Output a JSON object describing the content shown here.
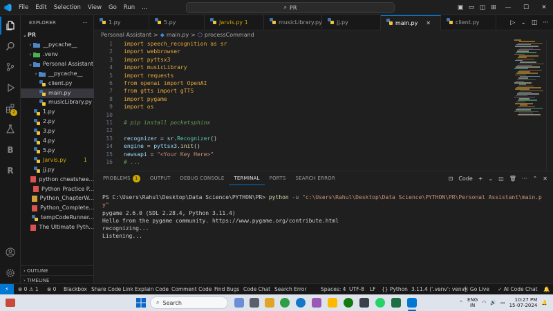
{
  "titlebar": {
    "menu": [
      "File",
      "Edit",
      "Selection",
      "View",
      "Go",
      "Run",
      "..."
    ],
    "search": "PR"
  },
  "sidebar": {
    "header": "EXPLORER",
    "root": "PR",
    "items": [
      {
        "label": "__pycache__",
        "depth": 1,
        "kind": "folder"
      },
      {
        "label": ".venv",
        "depth": 1,
        "kind": "folder"
      },
      {
        "label": "Personal Assistant",
        "depth": 1,
        "kind": "folder-open"
      },
      {
        "label": "__pycache__",
        "depth": 2,
        "kind": "folder"
      },
      {
        "label": "client.py",
        "depth": 2,
        "kind": "py"
      },
      {
        "label": "main.py",
        "depth": 2,
        "kind": "py",
        "selected": true
      },
      {
        "label": "musicLibrary.py",
        "depth": 2,
        "kind": "py"
      },
      {
        "label": "1.py",
        "depth": 1,
        "kind": "py"
      },
      {
        "label": "2.py",
        "depth": 1,
        "kind": "py"
      },
      {
        "label": "3.py",
        "depth": 1,
        "kind": "py"
      },
      {
        "label": "4.py",
        "depth": 1,
        "kind": "py"
      },
      {
        "label": "5.py",
        "depth": 1,
        "kind": "py"
      },
      {
        "label": "Jarvis.py",
        "depth": 1,
        "kind": "py",
        "warn": true,
        "badge": "1"
      },
      {
        "label": "jj.py",
        "depth": 1,
        "kind": "py"
      },
      {
        "label": "python cheatshee...",
        "depth": 1,
        "kind": "pdf"
      },
      {
        "label": "Python Practice P...",
        "depth": 1,
        "kind": "pdf"
      },
      {
        "label": "Python_ChapterW...",
        "depth": 1,
        "kind": "txt"
      },
      {
        "label": "Python_Complete...",
        "depth": 1,
        "kind": "pdf"
      },
      {
        "label": "tempCodeRunner...",
        "depth": 1,
        "kind": "py"
      },
      {
        "label": "The Ultimate Pyth...",
        "depth": 1,
        "kind": "pdf"
      }
    ],
    "outline": "OUTLINE",
    "timeline": "TIMELINE"
  },
  "tabs": [
    {
      "label": "1.py"
    },
    {
      "label": "5.py"
    },
    {
      "label": "Jarvis.py 1",
      "warn": true
    },
    {
      "label": "musicLibrary.py"
    },
    {
      "label": "jj.py"
    },
    {
      "label": "main.py",
      "active": true,
      "close": "✕"
    },
    {
      "label": "client.py"
    }
  ],
  "breadcrumb": [
    "Personal Assistant",
    ">",
    "main.py",
    ">",
    "processCommand"
  ],
  "editor": {
    "line_numbers": [
      "1",
      "2",
      "3",
      "4",
      "5",
      "6",
      "7",
      "8",
      "9",
      "10",
      "11",
      "12",
      "13",
      "14",
      "15",
      "16"
    ],
    "lines": [
      [
        {
          "t": "import",
          "c": "imp"
        },
        {
          "t": " speech_recognition ",
          "c": "imp"
        },
        {
          "t": "as",
          "c": "imp"
        },
        {
          "t": " sr",
          "c": "imp"
        }
      ],
      [
        {
          "t": "import",
          "c": "imp"
        },
        {
          "t": " webbrowser",
          "c": "imp"
        }
      ],
      [
        {
          "t": "import",
          "c": "imp"
        },
        {
          "t": " pyttsx3",
          "c": "imp"
        }
      ],
      [
        {
          "t": "import",
          "c": "imp"
        },
        {
          "t": " musicLibrary",
          "c": "imp"
        }
      ],
      [
        {
          "t": "import",
          "c": "imp"
        },
        {
          "t": " requests",
          "c": "imp"
        }
      ],
      [
        {
          "t": "from",
          "c": "imp"
        },
        {
          "t": " openai ",
          "c": "imp"
        },
        {
          "t": "import",
          "c": "imp"
        },
        {
          "t": " OpenAI",
          "c": "imp"
        }
      ],
      [
        {
          "t": "from",
          "c": "imp"
        },
        {
          "t": " gtts ",
          "c": "imp"
        },
        {
          "t": "import",
          "c": "imp"
        },
        {
          "t": " gTTS",
          "c": "imp"
        }
      ],
      [
        {
          "t": "import",
          "c": "imp"
        },
        {
          "t": " pygame",
          "c": "imp"
        }
      ],
      [
        {
          "t": "import",
          "c": "imp"
        },
        {
          "t": " os",
          "c": "imp"
        }
      ],
      [],
      [
        {
          "t": "# pip install pocketsphinx",
          "c": "com"
        }
      ],
      [],
      [
        {
          "t": "recognizer",
          "c": "plain"
        },
        {
          "t": " = ",
          "c": "plain"
        },
        {
          "t": "sr",
          "c": "plain"
        },
        {
          "t": ".",
          "c": "plain"
        },
        {
          "t": "Recognizer",
          "c": "plain"
        },
        {
          "t": "()",
          "c": "plain"
        }
      ],
      [
        {
          "t": "engine",
          "c": "plain"
        },
        {
          "t": " = ",
          "c": "plain"
        },
        {
          "t": "pyttsx3",
          "c": "plain"
        },
        {
          "t": ".",
          "c": "plain"
        },
        {
          "t": "init",
          "c": "plain"
        },
        {
          "t": "()",
          "c": "plain"
        }
      ],
      [
        {
          "t": "newsapi",
          "c": "plain"
        },
        {
          "t": " = ",
          "c": "plain"
        },
        {
          "t": "\"<Your Key Here>\"",
          "c": "plain"
        }
      ],
      [
        {
          "t": "# ...",
          "c": "com"
        }
      ]
    ]
  },
  "panel": {
    "tabs": [
      {
        "label": "PROBLEMS",
        "badge": "1"
      },
      {
        "label": "OUTPUT"
      },
      {
        "label": "DEBUG CONSOLE"
      },
      {
        "label": "TERMINAL",
        "active": true
      },
      {
        "label": "PORTS"
      },
      {
        "label": "SEARCH ERROR"
      }
    ],
    "terminal_kind": "Code",
    "terminal": {
      "prompt": "PS C:\\Users\\Rahul\\Desktop\\Data Science\\PYTHON\\PR> ",
      "cmd": "python",
      "flag": " -u ",
      "path": "\"c:\\Users\\Rahul\\Desktop\\Data Science\\PYTHON\\PR\\Personal Assistant\\main.p",
      "path_cont": "y\"",
      "out1": "pygame 2.6.0 (SDL 2.28.4, Python 3.11.4)",
      "out2": "Hello from the pygame community. https://www.pygame.org/contribute.html",
      "out3": "recognizing...",
      "out4": "Listening..."
    }
  },
  "statusbar": {
    "left": [
      "⊗ 0  ⚠ 1",
      "⊗ 0",
      "Blackbox",
      "Share Code Link",
      "Explain Code",
      "Comment Code",
      "Find Bugs",
      "Code Chat",
      "Search Error"
    ],
    "right": [
      "Spaces: 4",
      "UTF-8",
      "LF",
      "{} Python",
      "3.11.4 ('.venv': venv)",
      "Go Live",
      "AI Code Chat"
    ]
  },
  "taskbar": {
    "search": "Search",
    "lang1": "ENG",
    "lang2": "IN",
    "time": "10:27 PM",
    "date": "15-07-2024"
  },
  "colors": {
    "accent": "#0078d4",
    "warning": "#cca700",
    "keyword_import": "#e5a83a"
  }
}
